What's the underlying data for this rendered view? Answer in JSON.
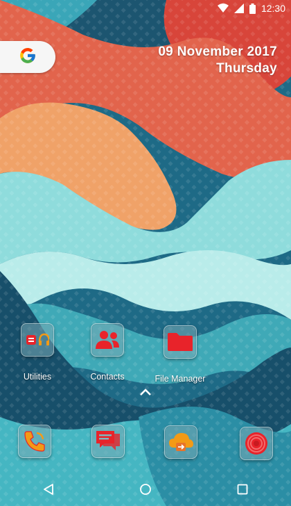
{
  "status_bar": {
    "time": "12:30"
  },
  "date_widget": {
    "date": "09 November 2017",
    "day": "Thursday"
  },
  "google_search": {
    "logo_letter": "G"
  },
  "home_apps": [
    {
      "label": "Utilities",
      "icon": "utilities-icon"
    },
    {
      "label": "Contacts",
      "icon": "contacts-icon"
    },
    {
      "label": "File Manager",
      "icon": "folder-icon"
    }
  ],
  "dock_apps": [
    {
      "icon": "phone-icon"
    },
    {
      "icon": "messages-icon"
    },
    {
      "icon": "cloud-sync-icon"
    },
    {
      "icon": "camera-icon"
    }
  ],
  "nav_bar": {
    "back": "back-icon",
    "home": "home-icon",
    "recents": "recents-icon"
  },
  "colors": {
    "icon_red": "#e8232a",
    "utilities_orange": "#f39a16"
  }
}
